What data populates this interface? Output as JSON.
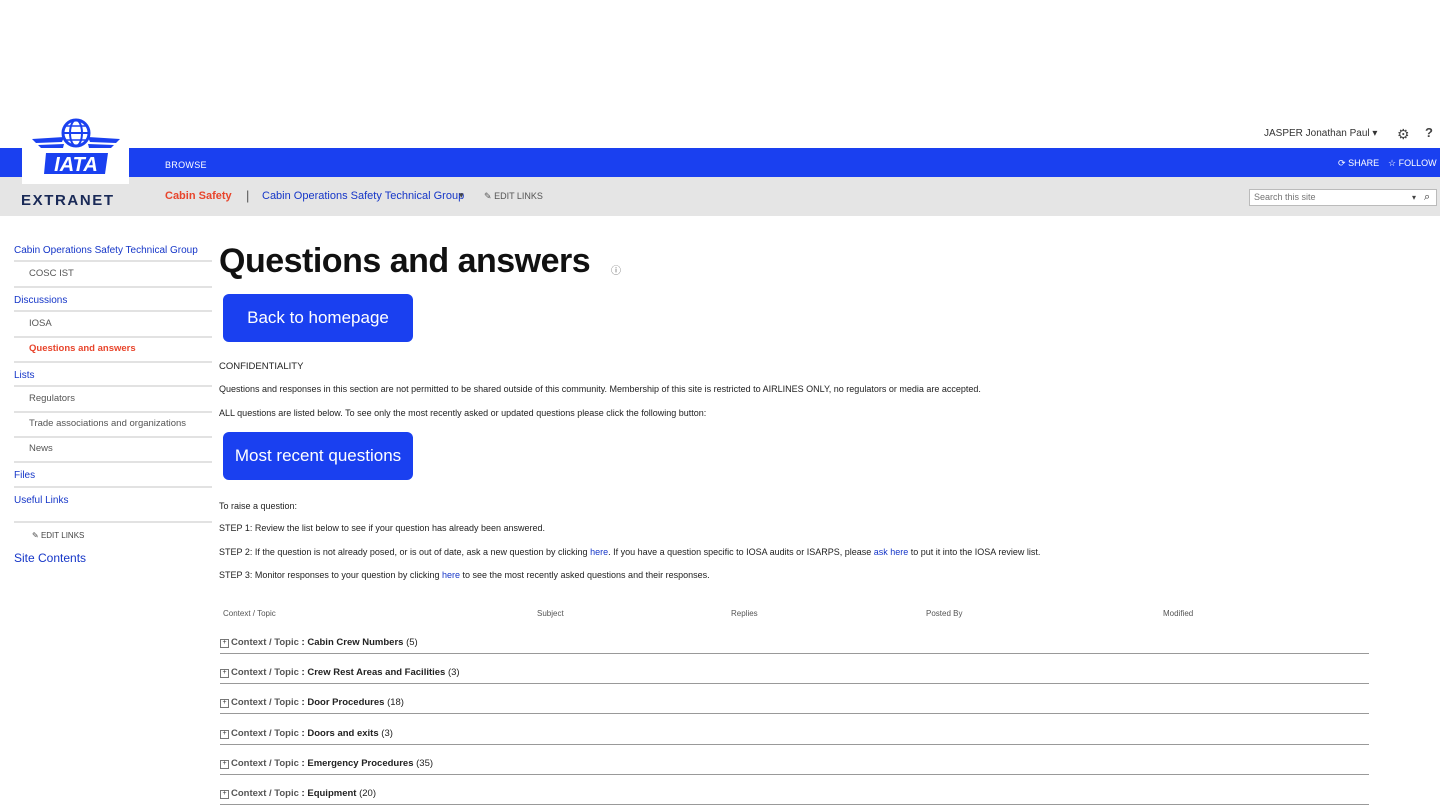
{
  "header": {
    "user_name": "JASPER Jonathan Paul",
    "user_caret": "▾",
    "gear_glyph": "⚙",
    "help_glyph": "?",
    "ribbon_tab": "BROWSE",
    "share_label": "SHARE",
    "follow_label": "FOLLOW",
    "logo_text": "IATA",
    "logo_subtitle": "EXTRANET",
    "brand_blue": "#1a40f0",
    "accent_red": "#e8452c"
  },
  "topnav": {
    "current": "Cabin Safety",
    "separator": "|",
    "group": "Cabin Operations Safety Technical Group",
    "caret": "▾",
    "edit_links": "EDIT LINKS"
  },
  "search": {
    "placeholder": "Search this site"
  },
  "leftnav": {
    "items": [
      {
        "label": "Cabin Operations Safety Technical Group"
      },
      {
        "label": "COSC IST"
      },
      {
        "label": "Discussions"
      },
      {
        "label": "IOSA"
      },
      {
        "label": "Questions and answers"
      },
      {
        "label": "Lists"
      },
      {
        "label": "Regulators"
      },
      {
        "label": "Trade associations and organizations"
      },
      {
        "label": "News"
      },
      {
        "label": "Files"
      },
      {
        "label": "Useful Links"
      }
    ],
    "edit_links": "EDIT LINKS",
    "site_contents": "Site Contents"
  },
  "main": {
    "title": "Questions and answers",
    "back_button": "Back to homepage",
    "confidentiality_heading": "CONFIDENTIALITY",
    "confidentiality_text": "Questions and responses in this section are not permitted to be shared outside of this community. Membership of this site is restricted to AIRLINES ONLY, no regulators or media are accepted.",
    "all_questions_text": "ALL questions are listed below.  To see only the most recently asked or updated questions please click the following button:",
    "recent_button": "Most recent questions",
    "raise_intro": "To raise a question:",
    "step1": "STEP 1: Review the list below to see if your question has already been answered.",
    "step2_a": "STEP 2: If the question is not already posed, or is out of date, ask a new question by clicking ",
    "step2_link1": "here",
    "step2_b": ".  If you have a question specific to IOSA audits or ISARPS, please ",
    "step2_link2": "ask here",
    "step2_c": " to put it into the IOSA review list.",
    "step3_a": "STEP 3: Monitor responses to your question by clicking ",
    "step3_link": "here",
    "step3_b": " to see the most recently asked questions and their responses."
  },
  "list": {
    "columns": [
      "Context / Topic",
      "Subject",
      "Replies",
      "Posted By",
      "Modified"
    ],
    "group_prefix": "Context / Topic",
    "groups": [
      {
        "topic": "Cabin Crew Numbers",
        "count": "(5)"
      },
      {
        "topic": "Crew Rest Areas and Facilities",
        "count": "(3)"
      },
      {
        "topic": "Door Procedures",
        "count": "(18)"
      },
      {
        "topic": "Doors and exits",
        "count": "(3)"
      },
      {
        "topic": "Emergency Procedures",
        "count": "(35)"
      },
      {
        "topic": "Equipment",
        "count": "(20)"
      }
    ]
  }
}
